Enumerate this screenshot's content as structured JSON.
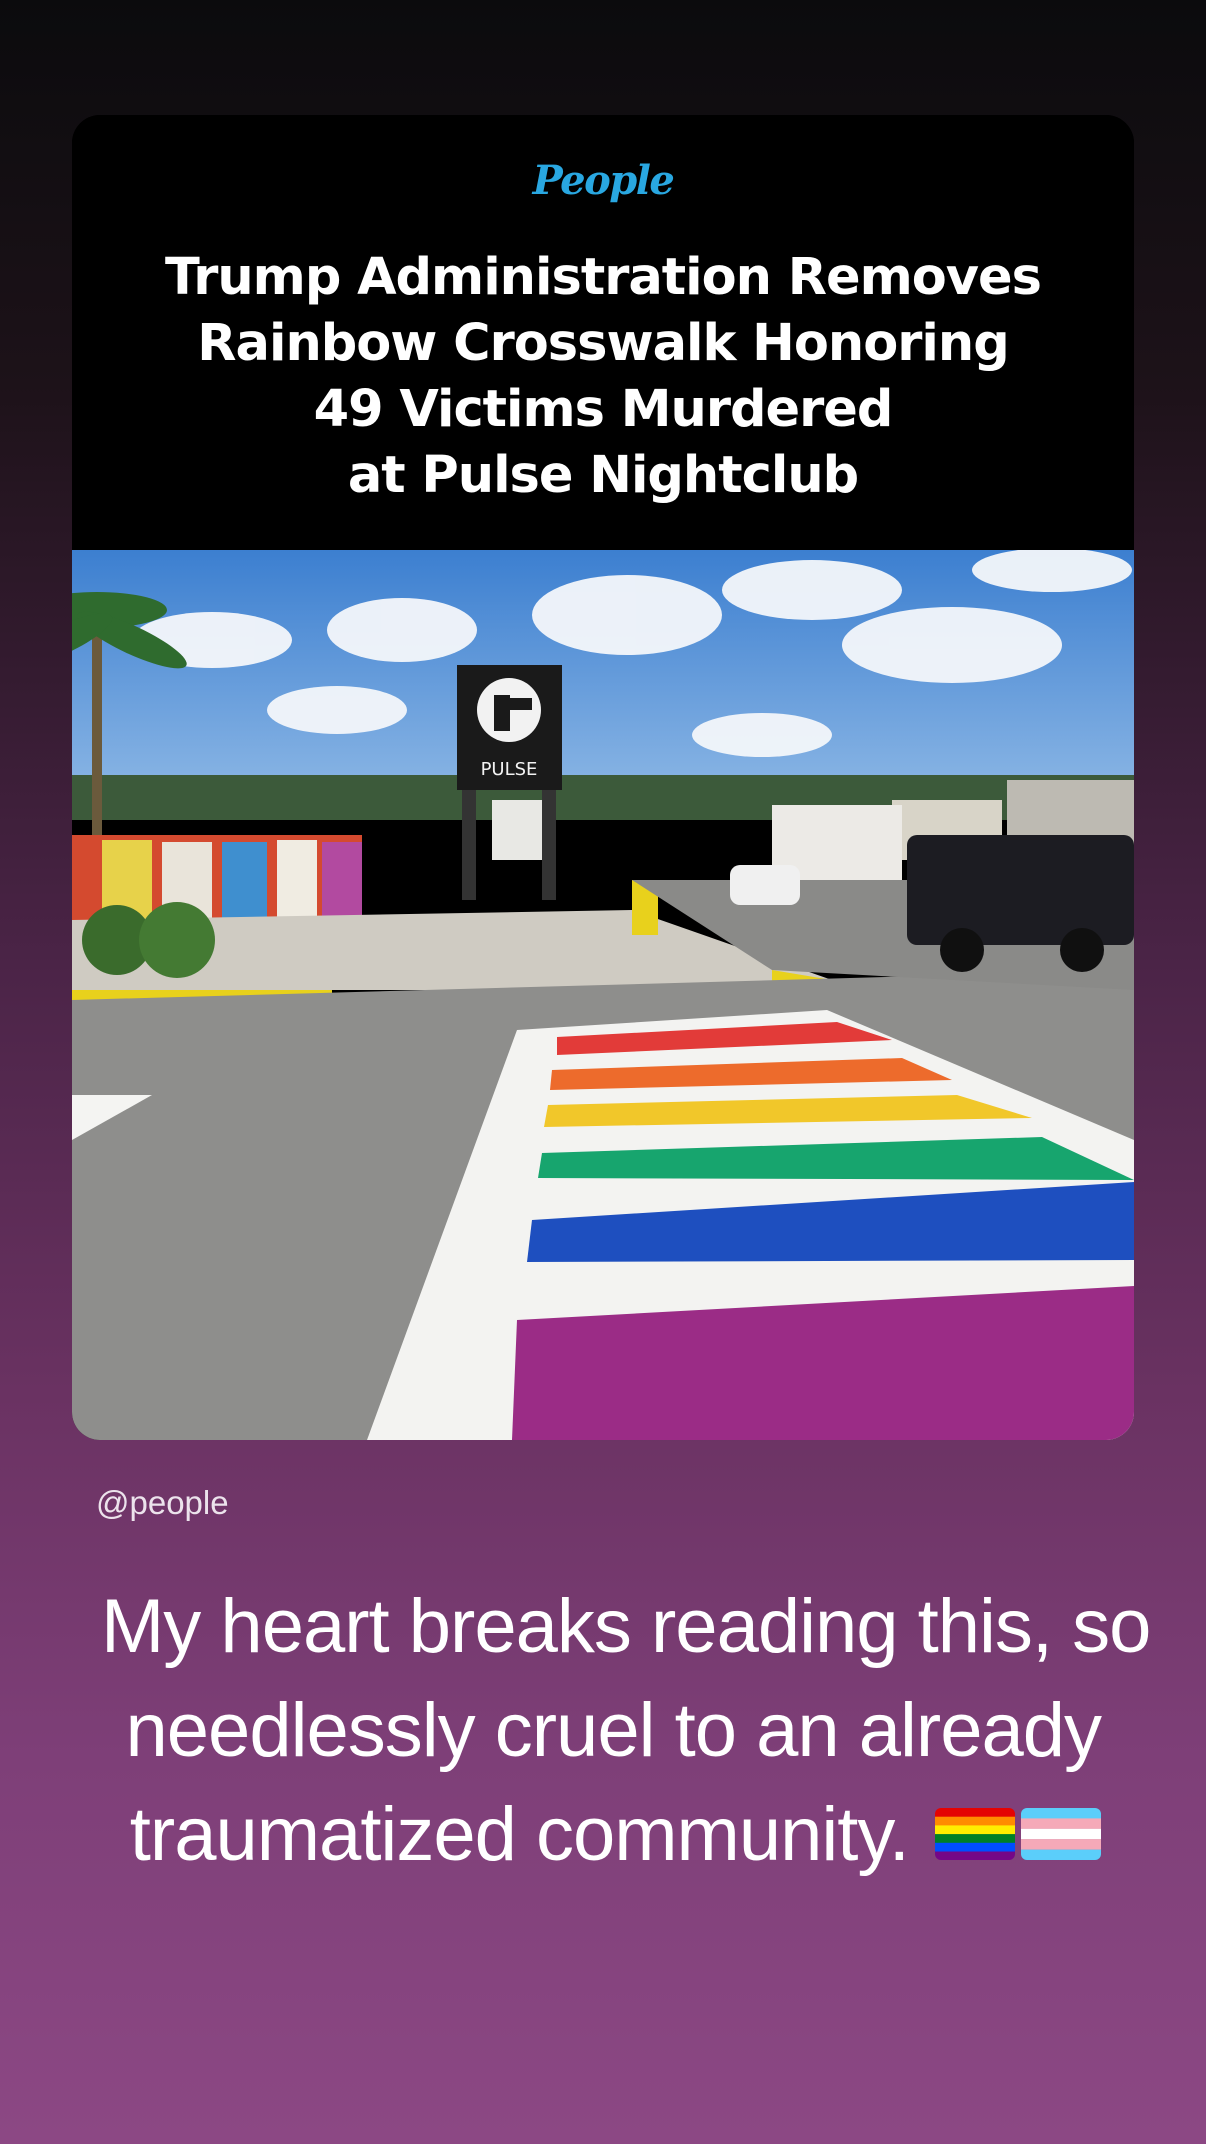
{
  "post": {
    "brand": "People",
    "headline_lines": [
      "Trump Administration Removes",
      "Rainbow Crosswalk Honoring",
      "49 Victims Murdered",
      "at Pulse Nightclub"
    ],
    "photo_sign_text": "PULSE",
    "handle": "@people"
  },
  "caption": {
    "lines": [
      "My heart breaks reading this, so",
      "needlessly cruel to an already",
      "traumatized community."
    ],
    "emojis": [
      "rainbow-flag-icon",
      "transgender-flag-icon"
    ]
  },
  "colors": {
    "brand": "#29a7e1",
    "background_top": "#0b0b0d",
    "background_bottom": "#8c4884"
  }
}
